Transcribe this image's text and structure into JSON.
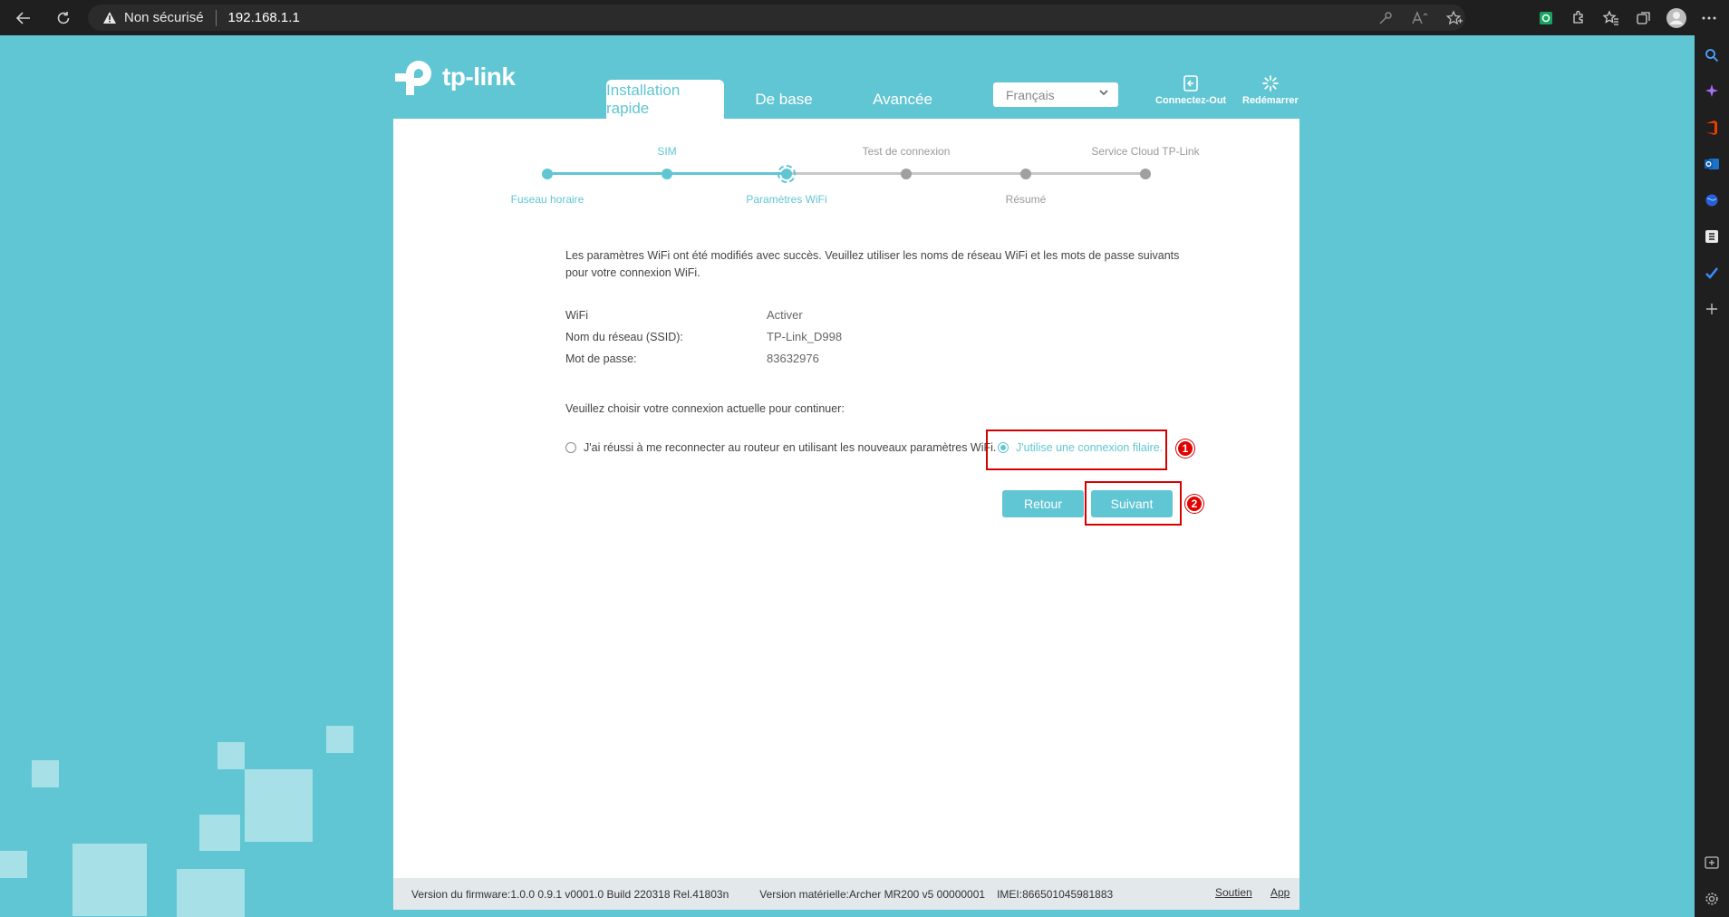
{
  "browser": {
    "security_label": "Non sécurisé",
    "url": "192.168.1.1"
  },
  "header": {
    "logo_text": "tp-link",
    "tabs": [
      {
        "label": "Installation rapide",
        "active": true
      },
      {
        "label": "De base",
        "active": false
      },
      {
        "label": "Avancée",
        "active": false
      }
    ],
    "language": "Français",
    "logout_label": "Connectez-Out",
    "reboot_label": "Redémarrer"
  },
  "stepper": {
    "steps": [
      {
        "label": "Fuseau horaire",
        "position": "below",
        "state": "done"
      },
      {
        "label": "SIM",
        "position": "above",
        "state": "done"
      },
      {
        "label": "Paramètres WiFi",
        "position": "below",
        "state": "current"
      },
      {
        "label": "Test de connexion",
        "position": "above",
        "state": "todo"
      },
      {
        "label": "Résumé",
        "position": "below",
        "state": "todo"
      },
      {
        "label": "Service Cloud TP-Link",
        "position": "above",
        "state": "todo"
      }
    ]
  },
  "main": {
    "message": "Les paramètres WiFi ont été modifiés avec succès. Veuillez utiliser les noms de réseau WiFi et les mots de passe suivants pour votre connexion WiFi.",
    "info": [
      {
        "label": "WiFi",
        "value": "Activer"
      },
      {
        "label": "Nom du réseau (SSID):",
        "value": "TP-Link_D998"
      },
      {
        "label": "Mot de passe:",
        "value": "83632976"
      }
    ],
    "prompt": "Veuillez choisir votre connexion actuelle pour continuer:",
    "option_wifi": "J'ai réussi à me reconnecter au routeur en utilisant les nouveaux paramètres WiFi.",
    "option_wired": "J'utilise une connexion filaire.",
    "back_label": "Retour",
    "next_label": "Suivant"
  },
  "annotations": {
    "badge_1": "1",
    "badge_2": "2"
  },
  "footer": {
    "firmware": "Version du firmware:1.0.0 0.9.1 v0001.0 Build 220318 Rel.41803n",
    "hardware": "Version matérielle:Archer MR200 v5 00000001",
    "imei": "IMEI:866501045981883",
    "support_label": "Soutien",
    "app_label": "App"
  },
  "colors": {
    "accent": "#61c6d3",
    "highlight": "#d60000"
  }
}
